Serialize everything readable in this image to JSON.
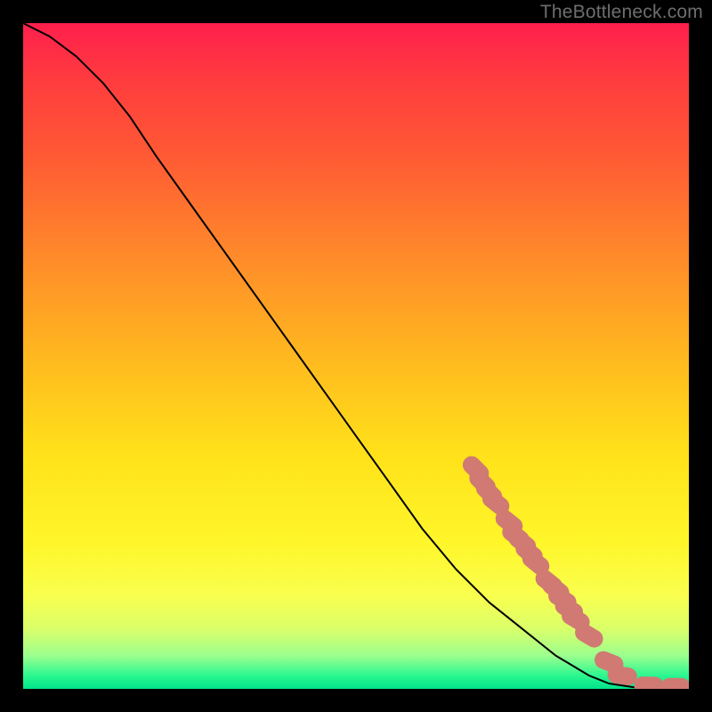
{
  "watermark": "TheBottleneck.com",
  "chart_data": {
    "type": "line",
    "title": "",
    "xlabel": "",
    "ylabel": "",
    "xlim": [
      0,
      100
    ],
    "ylim": [
      0,
      100
    ],
    "curve": {
      "x": [
        0,
        4,
        8,
        12,
        16,
        20,
        25,
        30,
        35,
        40,
        45,
        50,
        55,
        60,
        65,
        70,
        75,
        80,
        85,
        88,
        92,
        96,
        100
      ],
      "y": [
        100,
        98,
        95,
        91,
        86,
        80,
        73,
        66,
        59,
        52,
        45,
        38,
        31,
        24,
        18,
        13,
        9,
        5,
        2,
        0.8,
        0.2,
        0.1,
        0.1
      ]
    },
    "markers": [
      {
        "x": 68,
        "y": 33
      },
      {
        "x": 69,
        "y": 31
      },
      {
        "x": 70,
        "y": 29.5
      },
      {
        "x": 71,
        "y": 28
      },
      {
        "x": 73,
        "y": 25
      },
      {
        "x": 74,
        "y": 23
      },
      {
        "x": 75,
        "y": 22
      },
      {
        "x": 76,
        "y": 20.5
      },
      {
        "x": 77,
        "y": 19
      },
      {
        "x": 79,
        "y": 16
      },
      {
        "x": 80,
        "y": 15
      },
      {
        "x": 81,
        "y": 13.5
      },
      {
        "x": 82,
        "y": 12
      },
      {
        "x": 83,
        "y": 10.5
      },
      {
        "x": 85,
        "y": 8
      },
      {
        "x": 88,
        "y": 4
      },
      {
        "x": 90,
        "y": 2
      },
      {
        "x": 94,
        "y": 0.5
      },
      {
        "x": 98,
        "y": 0.3
      }
    ],
    "marker_radius": 9,
    "colors": {
      "curve": "#000000",
      "markers": "#d07a73",
      "gradient_top": "#ff1f4d",
      "gradient_bottom": "#00e48a"
    }
  }
}
